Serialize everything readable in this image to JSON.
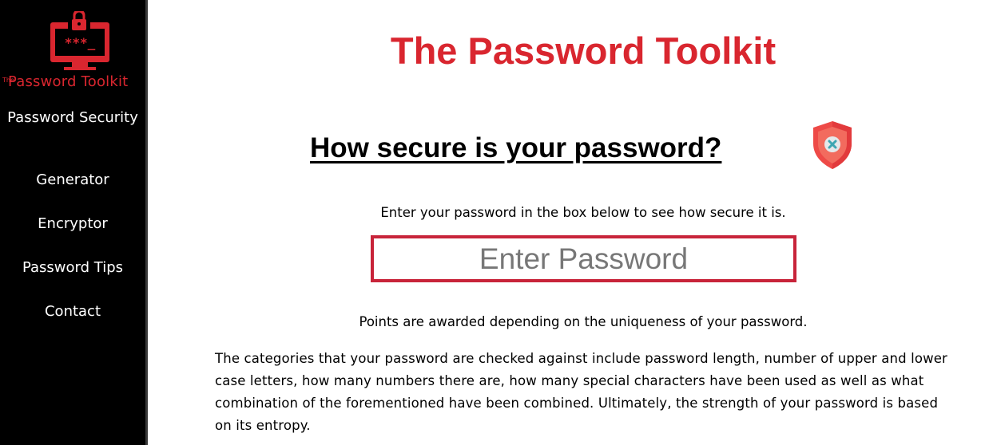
{
  "sidebar": {
    "logo": {
      "the": "The",
      "name": "Password Toolkit",
      "screen_text": "***_"
    },
    "nav": [
      {
        "label": "Password Security"
      },
      {
        "label": "Generator"
      },
      {
        "label": "Encryptor"
      },
      {
        "label": "Password Tips"
      },
      {
        "label": "Contact"
      }
    ]
  },
  "main": {
    "title": "The Password Toolkit",
    "heading": "How secure is your password?",
    "heading_icon": "shield-x-icon",
    "instruction": "Enter your password in the box below to see how secure it is.",
    "password_input": {
      "placeholder": "Enter Password",
      "value": ""
    },
    "points_text": "Points are awarded depending on the uniqueness of your password.",
    "categories_text": "The categories that your password are checked against include password length, number of upper and lower case letters, how many numbers there are, how many special characters have been used as well as what combination of the forementioned have been combined. Ultimately, the strength of your password is based on its entropy."
  },
  "colors": {
    "brand_red": "#d9262f",
    "sidebar_bg": "#000000",
    "input_border": "#c8243a"
  }
}
